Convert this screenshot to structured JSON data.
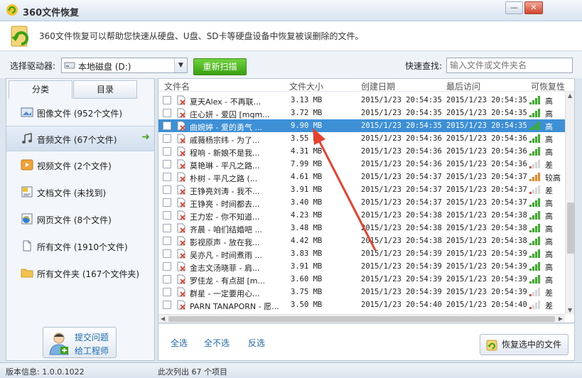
{
  "window": {
    "title": "360文件恢复",
    "min_label": "—",
    "close_label": "✕"
  },
  "info": {
    "text": "360文件恢复可以帮助您快速从硬盘、U盘、SD卡等硬盘设备中恢复被误删除的文件。"
  },
  "toolbar": {
    "drive_label": "选择驱动器:",
    "drive_value": "本地磁盘 (D:)",
    "rescan_label": "重新扫描",
    "search_label": "快速查找:",
    "search_placeholder": "输入文件或文件夹名"
  },
  "left": {
    "tabs": [
      {
        "label": "分类"
      },
      {
        "label": "目录"
      }
    ],
    "categories": [
      {
        "label": "图像文件 (952个文件)",
        "icon": "image-icon"
      },
      {
        "label": "音频文件 (67个文件)",
        "icon": "music-icon",
        "selected": true
      },
      {
        "label": "视频文件 (2个文件)",
        "icon": "video-icon"
      },
      {
        "label": "文档文件 (未找到)",
        "icon": "document-icon"
      },
      {
        "label": "网页文件 (8个文件)",
        "icon": "webpage-icon"
      },
      {
        "label": "所有文件 (1910个文件)",
        "icon": "file-icon"
      },
      {
        "label": "所有文件夹 (167个文件夹)",
        "icon": "folder-icon"
      }
    ],
    "engineer_line1": "提交问题",
    "engineer_line2": "给工程师"
  },
  "list": {
    "columns": {
      "name": "文件名",
      "size": "文件大小",
      "created": "创建日期",
      "accessed": "最后访问",
      "recoverability": "可恢复性"
    },
    "rows": [
      {
        "name": "夏天Alex - 不再联...",
        "size": "3.13 MB",
        "created": "2015/1/23 20:54:35",
        "accessed": "2015/1/23 20:54:35",
        "level": "高"
      },
      {
        "name": "庄心妍 - 爱囚 [mqm...",
        "size": "3.72 MB",
        "created": "2015/1/23 20:54:35",
        "accessed": "2015/1/23 20:54:35",
        "level": "高"
      },
      {
        "name": "曲婉婷 - 爱的勇气 ...",
        "size": "9.90 MB",
        "created": "2015/1/23 20:54:35",
        "accessed": "2015/1/23 20:54:35",
        "level": "高",
        "selected": true
      },
      {
        "name": "戚薇杨宗纬 - 为了...",
        "size": "3.55 MB",
        "created": "2015/1/23 20:54:36",
        "accessed": "2015/1/23 20:54:36",
        "level": "高"
      },
      {
        "name": "程响 - 新娘不是我...",
        "size": "4.31 MB",
        "created": "2015/1/23 20:54:36",
        "accessed": "2015/1/23 20:54:36",
        "level": "高"
      },
      {
        "name": "莫艳琳 - 平凡之路...",
        "size": "7.99 MB",
        "created": "2015/1/23 20:54:36",
        "accessed": "2015/1/23 20:54:36",
        "level": "差"
      },
      {
        "name": "朴树 - 平凡之路 (...",
        "size": "4.61 MB",
        "created": "2015/1/23 20:54:37",
        "accessed": "2015/1/23 20:54:37",
        "level": "较高"
      },
      {
        "name": "王铮亮刘涛 - 我不...",
        "size": "3.91 MB",
        "created": "2015/1/23 20:54:37",
        "accessed": "2015/1/23 20:54:37",
        "level": "差"
      },
      {
        "name": "王铮亮 - 时间都去...",
        "size": "3.40 MB",
        "created": "2015/1/23 20:54:37",
        "accessed": "2015/1/23 20:54:37",
        "level": "高"
      },
      {
        "name": "王力宏 - 你不知道...",
        "size": "4.23 MB",
        "created": "2015/1/23 20:54:38",
        "accessed": "2015/1/23 20:54:38",
        "level": "高"
      },
      {
        "name": "齐晨 - 咱们结婚吧 ...",
        "size": "3.48 MB",
        "created": "2015/1/23 20:54:38",
        "accessed": "2015/1/23 20:54:38",
        "level": "高"
      },
      {
        "name": "影视原声 - 放在我...",
        "size": "4.42 MB",
        "created": "2015/1/23 20:54:38",
        "accessed": "2015/1/23 20:54:38",
        "level": "高"
      },
      {
        "name": "吴亦凡 - 时间煮雨 ...",
        "size": "3.83 MB",
        "created": "2015/1/23 20:54:39",
        "accessed": "2015/1/23 20:54:39",
        "level": "高"
      },
      {
        "name": "金志文汤晓菲 - 肩...",
        "size": "3.91 MB",
        "created": "2015/1/23 20:54:39",
        "accessed": "2015/1/23 20:54:39",
        "level": "高"
      },
      {
        "name": "罗佳龙 - 有点甜 [m...",
        "size": "3.60 MB",
        "created": "2015/1/23 20:54:39",
        "accessed": "2015/1/23 20:54:39",
        "level": "高"
      },
      {
        "name": "群星 - 一定要用心...",
        "size": "3.75 MB",
        "created": "2015/1/23 20:54:39",
        "accessed": "2015/1/23 20:54:39",
        "level": "差"
      },
      {
        "name": "PARN TANAPORN - 愿...",
        "size": "3.50 MB",
        "created": "2015/1/23 20:54:40",
        "accessed": "2015/1/23 20:54:40",
        "level": "差"
      }
    ]
  },
  "bottom": {
    "select_all": "全选",
    "select_none": "全不选",
    "invert": "反选",
    "recover_label": "恢复选中的文件"
  },
  "status": {
    "version": "版本信息: 1.0.0.1022",
    "count": "此次列出 67 个项目"
  },
  "colors": {
    "accent": "#3d8fd6",
    "green": "#4aa51c",
    "high": "#3cae2a",
    "medium": "#e8862c",
    "low": "#d94a3a"
  }
}
